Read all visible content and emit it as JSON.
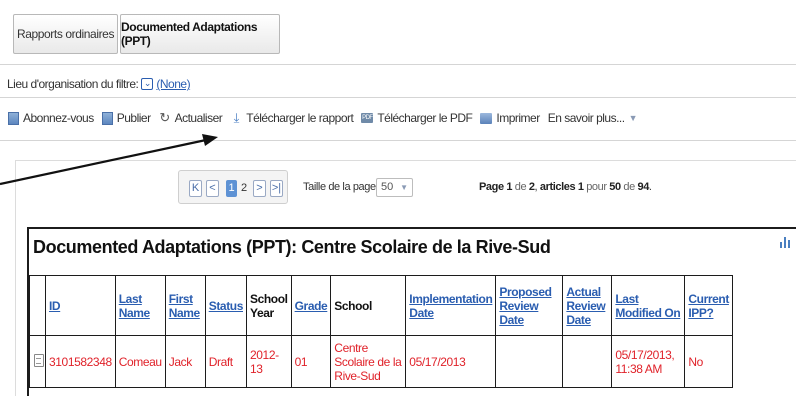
{
  "breadcrumb": {
    "items": [
      "Rapports ordinaires",
      "Documented Adaptations (PPT)"
    ]
  },
  "filter": {
    "label": "Lieu d'organisation du filtre:",
    "value": "(None)"
  },
  "toolbar": {
    "subscribe": "Abonnez-vous",
    "publish": "Publier",
    "refresh": "Actualiser",
    "download_report": "Télécharger le rapport",
    "download_pdf": "Télécharger le PDF",
    "print": "Imprimer",
    "more": "En savoir plus..."
  },
  "pager": {
    "current_page": "1",
    "next_page": "2",
    "page_size_label": "Taille de la page:",
    "page_size": "50",
    "info": {
      "page_word": "Page",
      "page": "1",
      "of1": "de",
      "total_pages": "2",
      "articles_word": "articles",
      "from": "1",
      "to_word": "pour",
      "to": "50",
      "of2": "de",
      "total": "94"
    }
  },
  "report": {
    "title": "Documented Adaptations (PPT): Centre Scolaire de la Rive-Sud",
    "columns": [
      "ID",
      "Last Name",
      "First Name",
      "Status",
      "School Year",
      "Grade",
      "School",
      "Implementation Date",
      "Proposed Review Date",
      "Actual Review Date",
      "Last Modified On",
      "Current IPP?"
    ],
    "rows": [
      {
        "id": "3101582348",
        "last_name": "Comeau",
        "first_name": "Jack",
        "status": "Draft",
        "school_year": "2012-13",
        "grade": "01",
        "school": "Centre Scolaire de la Rive-Sud",
        "implementation_date": "05/17/2013",
        "proposed_review_date": "",
        "actual_review_date": "",
        "last_modified_on": "05/17/2013, 11:38 AM",
        "current_ipp": "No"
      }
    ]
  },
  "colors": {
    "link": "#2a5db0",
    "row_text": "#e0222a",
    "page_active": "#5e92d4"
  }
}
